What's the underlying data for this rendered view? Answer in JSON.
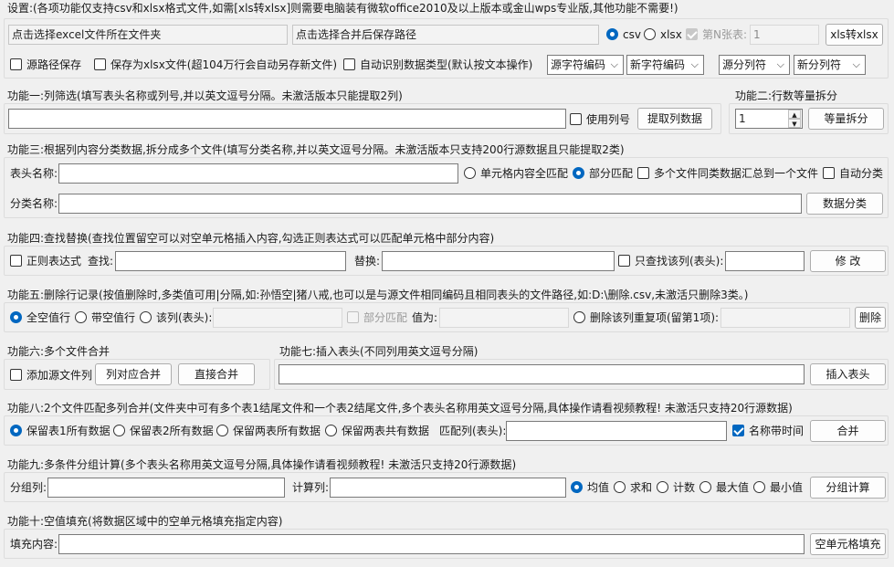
{
  "settings": {
    "title": "设置:(各项功能仅支持csv和xlsx格式文件,如需[xls转xlsx]则需要电脑装有微软office2010及以上版本或金山wps专业版,其他功能不需要!)",
    "source_folder_placeholder": "点击选择excel文件所在文件夹",
    "save_path_placeholder": "点击选择合并后保存路径",
    "radio_csv": "csv",
    "radio_xlsx": "xlsx",
    "sheet_n_label": "第N张表:",
    "sheet_n_value": "1",
    "xls2xlsx_button": "xls转xlsx",
    "cb_source_path_save": "源路径保存",
    "cb_save_as_xlsx": "保存为xlsx文件(超104万行会自动另存新文件)",
    "cb_auto_detect": "自动识别数据类型(默认按文本操作)",
    "source_encoding": "源字符编码",
    "new_encoding": "新字符编码",
    "source_delimiter": "源分列符",
    "new_delimiter": "新分列符"
  },
  "f1": {
    "title": "功能一:列筛选(填写表头名称或列号,并以英文逗号分隔。未激活版本只能提取2列)",
    "use_colnum": "使用列号",
    "button": "提取列数据"
  },
  "f2": {
    "title": "功能二:行数等量拆分",
    "value": "1",
    "button": "等量拆分"
  },
  "f3": {
    "title": "功能三:根据列内容分类数据,拆分成多个文件(填写分类名称,并以英文逗号分隔。未激活版本只支持200行源数据且只能提取2类)",
    "header_label": "表头名称:",
    "radio_full": "单元格内容全匹配",
    "radio_partial": "部分匹配",
    "cb_merge": "多个文件同类数据汇总到一个文件",
    "cb_auto": "自动分类",
    "category_label": "分类名称:",
    "button": "数据分类"
  },
  "f4": {
    "title": "功能四:查找替换(查找位置留空可以对空单元格插入内容,勾选正则表达式可以匹配单元格中部分内容)",
    "cb_regex": "正则表达式",
    "find_label": "查找:",
    "replace_label": "替换:",
    "cb_only_col": "只查找该列(表头):",
    "button": "修 改"
  },
  "f5": {
    "title": "功能五:删除行记录(按值删除时,多类值可用|分隔,如:孙悟空|猪八戒,也可以是与源文件相同编码且相同表头的文件路径,如:D:\\删除.csv,未激活只删除3类。)",
    "radio_all_empty": "全空值行",
    "radio_has_empty": "带空值行",
    "radio_col": "该列(表头):",
    "cb_partial": "部分匹配",
    "value_label": "值为:",
    "radio_dup": "删除该列重复项(留第1项):",
    "button": "删除"
  },
  "f6": {
    "title": "功能六:多个文件合并",
    "cb_add_source_col": "添加源文件列",
    "button_col": "列对应合并",
    "button_direct": "直接合并"
  },
  "f7": {
    "title": "功能七:插入表头(不同列用英文逗号分隔)",
    "button": "插入表头"
  },
  "f8": {
    "title": "功能八:2个文件匹配多列合并(文件夹中可有多个表1结尾文件和一个表2结尾文件,多个表头名称用英文逗号分隔,具体操作请看视频教程! 未激活只支持20行源数据)",
    "r1": "保留表1所有数据",
    "r2": "保留表2所有数据",
    "r3": "保留两表所有数据",
    "r4": "保留两表共有数据",
    "match_label": "匹配列(表头):",
    "cb_time": "名称带时间",
    "button": "合并"
  },
  "f9": {
    "title": "功能九:多条件分组计算(多个表头名称用英文逗号分隔,具体操作请看视频教程! 未激活只支持20行源数据)",
    "group_label": "分组列:",
    "calc_label": "计算列:",
    "r_mean": "均值",
    "r_sum": "求和",
    "r_count": "计数",
    "r_max": "最大值",
    "r_min": "最小值",
    "button": "分组计算"
  },
  "f10": {
    "title": "功能十:空值填充(将数据区域中的空单元格填充指定内容)",
    "fill_label": "填充内容:",
    "button": "空单元格填充"
  }
}
